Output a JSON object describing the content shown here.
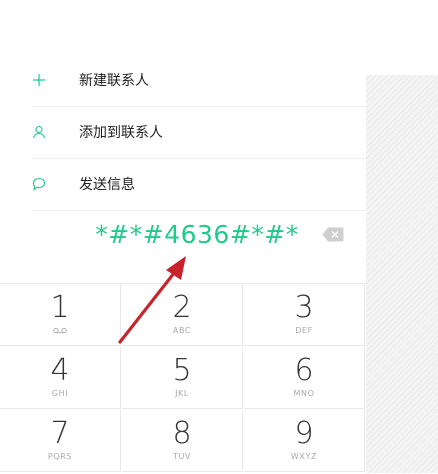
{
  "menu": {
    "items": [
      {
        "label": "新建联系人",
        "icon": "plus-icon"
      },
      {
        "label": "添加到联系人",
        "icon": "person-icon"
      },
      {
        "label": "发送信息",
        "icon": "chat-bubble-icon"
      }
    ]
  },
  "dialer": {
    "number": "*#*#4636#*#*",
    "delete_icon": "backspace-icon"
  },
  "keypad": {
    "keys": [
      {
        "digit": "1",
        "letters": ""
      },
      {
        "digit": "2",
        "letters": "ABC"
      },
      {
        "digit": "3",
        "letters": "DEF"
      },
      {
        "digit": "4",
        "letters": "GHI"
      },
      {
        "digit": "5",
        "letters": "JKL"
      },
      {
        "digit": "6",
        "letters": "MNO"
      },
      {
        "digit": "7",
        "letters": "PQRS"
      },
      {
        "digit": "8",
        "letters": "TUV"
      },
      {
        "digit": "9",
        "letters": "WXYZ"
      }
    ]
  },
  "colors": {
    "accent": "#1fcb8a",
    "arrow": "#c8232c"
  }
}
